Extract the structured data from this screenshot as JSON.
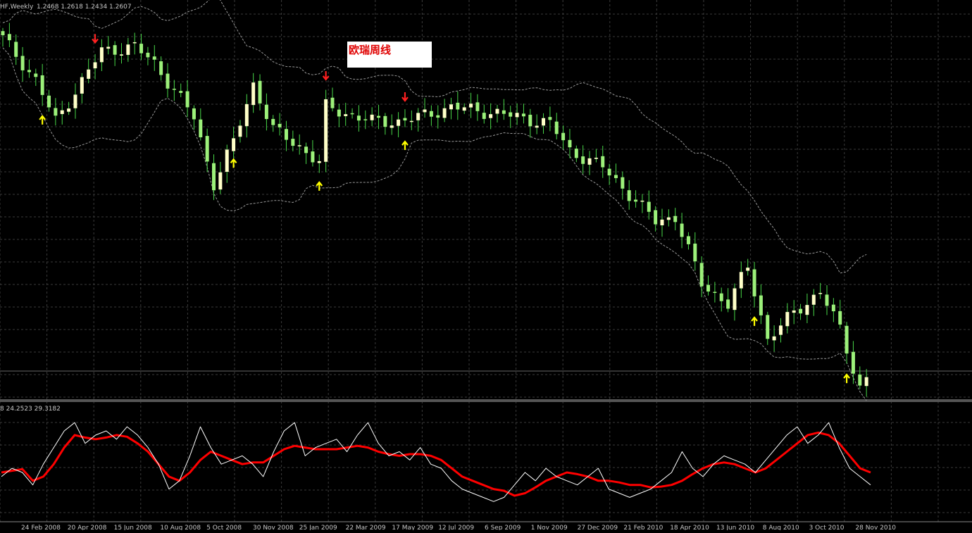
{
  "header": {
    "symbol_label": "HF,Weekly",
    "ohlc_label": "1.2468 1.2618 1.2434 1.2607",
    "subwindow_label": "8 24.2523 29.3182"
  },
  "annotation": {
    "title": "欧瑞周线"
  },
  "colors": {
    "background": "#000000",
    "grid": "#3a3a3a",
    "candle_bull": "#ffffc8",
    "candle_bear": "#9cf07a",
    "wick": "#48d848",
    "band": "#9a9a9a",
    "signal_up": "#ffff00",
    "signal_down": "#ff2020",
    "osc_main": "#ff0000",
    "osc_fast": "#ffffff"
  },
  "chart_data": [
    {
      "type": "candlestick",
      "grid": true,
      "indicators": [
        "bollinger-bands"
      ],
      "x_tick_labels": [
        "24 Feb 2008",
        "20 Apr 2008",
        "15 Jun 2008",
        "10 Aug 2008",
        "5 Oct 2008",
        "30 Nov 2008",
        "25 Jan 2009",
        "22 Mar 2009",
        "17 May 2009",
        "12 Jul 2009",
        "6 Sep 2009",
        "1 Nov 2009",
        "27 Dec 2009",
        "21 Feb 2010",
        "18 Apr 2010",
        "13 Jun 2010",
        "8 Aug 2010",
        "3 Oct 2010",
        "28 Nov 2010"
      ],
      "price_anchors": [
        {
          "week": 0,
          "price": 90
        },
        {
          "week": 5,
          "price": 70
        },
        {
          "week": 8,
          "price": 50
        },
        {
          "week": 15,
          "price": 84
        },
        {
          "week": 20,
          "price": 86
        },
        {
          "week": 23,
          "price": 78
        },
        {
          "week": 29,
          "price": 52
        },
        {
          "week": 32,
          "price": 20
        },
        {
          "week": 35,
          "price": 40
        },
        {
          "week": 38,
          "price": 68
        },
        {
          "week": 41,
          "price": 46
        },
        {
          "week": 45,
          "price": 38
        },
        {
          "week": 48,
          "price": 30
        },
        {
          "week": 49,
          "price": 57
        },
        {
          "week": 52,
          "price": 54
        },
        {
          "week": 56,
          "price": 50
        },
        {
          "week": 60,
          "price": 50
        },
        {
          "week": 63,
          "price": 52
        },
        {
          "week": 68,
          "price": 57
        },
        {
          "week": 75,
          "price": 54
        },
        {
          "week": 83,
          "price": 49
        },
        {
          "week": 86,
          "price": 36
        },
        {
          "week": 91,
          "price": 28
        },
        {
          "week": 95,
          "price": 15
        },
        {
          "week": 99,
          "price": 2
        },
        {
          "week": 102,
          "price": 4
        },
        {
          "week": 106,
          "price": -28
        },
        {
          "week": 110,
          "price": -38
        },
        {
          "week": 113,
          "price": -20
        },
        {
          "week": 116,
          "price": -55
        },
        {
          "week": 120,
          "price": -42
        },
        {
          "week": 124,
          "price": -32
        },
        {
          "week": 127,
          "price": -50
        },
        {
          "week": 130,
          "price": -78
        },
        {
          "week": 131,
          "price": -74
        }
      ],
      "up_signals_weeks": [
        6,
        35,
        48,
        61,
        114,
        128
      ],
      "down_signals_weeks": [
        14,
        49,
        61
      ]
    },
    {
      "type": "line",
      "series": [
        {
          "color": "#ff0000",
          "values": [
            50,
            52,
            54,
            40,
            45,
            60,
            80,
            95,
            92,
            90,
            92,
            95,
            93,
            85,
            75,
            60,
            45,
            40,
            50,
            65,
            75,
            70,
            65,
            60,
            62,
            62,
            70,
            78,
            82,
            80,
            78,
            78,
            78,
            80,
            82,
            80,
            75,
            72,
            70,
            72,
            72,
            70,
            65,
            55,
            45,
            40,
            35,
            30,
            28,
            22,
            25,
            32,
            40,
            45,
            50,
            48,
            45,
            40,
            40,
            38,
            35,
            35,
            32,
            33,
            35,
            40,
            48,
            55,
            60,
            62,
            60,
            55,
            50,
            55,
            65,
            75,
            85,
            95,
            98,
            95,
            85,
            70,
            55,
            50
          ]
        },
        {
          "color": "#ffffff",
          "values": [
            45,
            55,
            50,
            35,
            60,
            80,
            100,
            110,
            85,
            95,
            100,
            90,
            105,
            95,
            80,
            60,
            30,
            40,
            70,
            105,
            80,
            60,
            65,
            70,
            60,
            45,
            75,
            100,
            110,
            70,
            80,
            85,
            90,
            75,
            95,
            110,
            85,
            70,
            75,
            65,
            80,
            60,
            55,
            40,
            30,
            25,
            20,
            15,
            20,
            35,
            50,
            40,
            55,
            45,
            40,
            35,
            45,
            55,
            30,
            25,
            20,
            25,
            30,
            40,
            50,
            75,
            55,
            45,
            60,
            70,
            65,
            60,
            50,
            65,
            80,
            95,
            105,
            85,
            95,
            110,
            80,
            55,
            45,
            35
          ]
        }
      ]
    }
  ]
}
